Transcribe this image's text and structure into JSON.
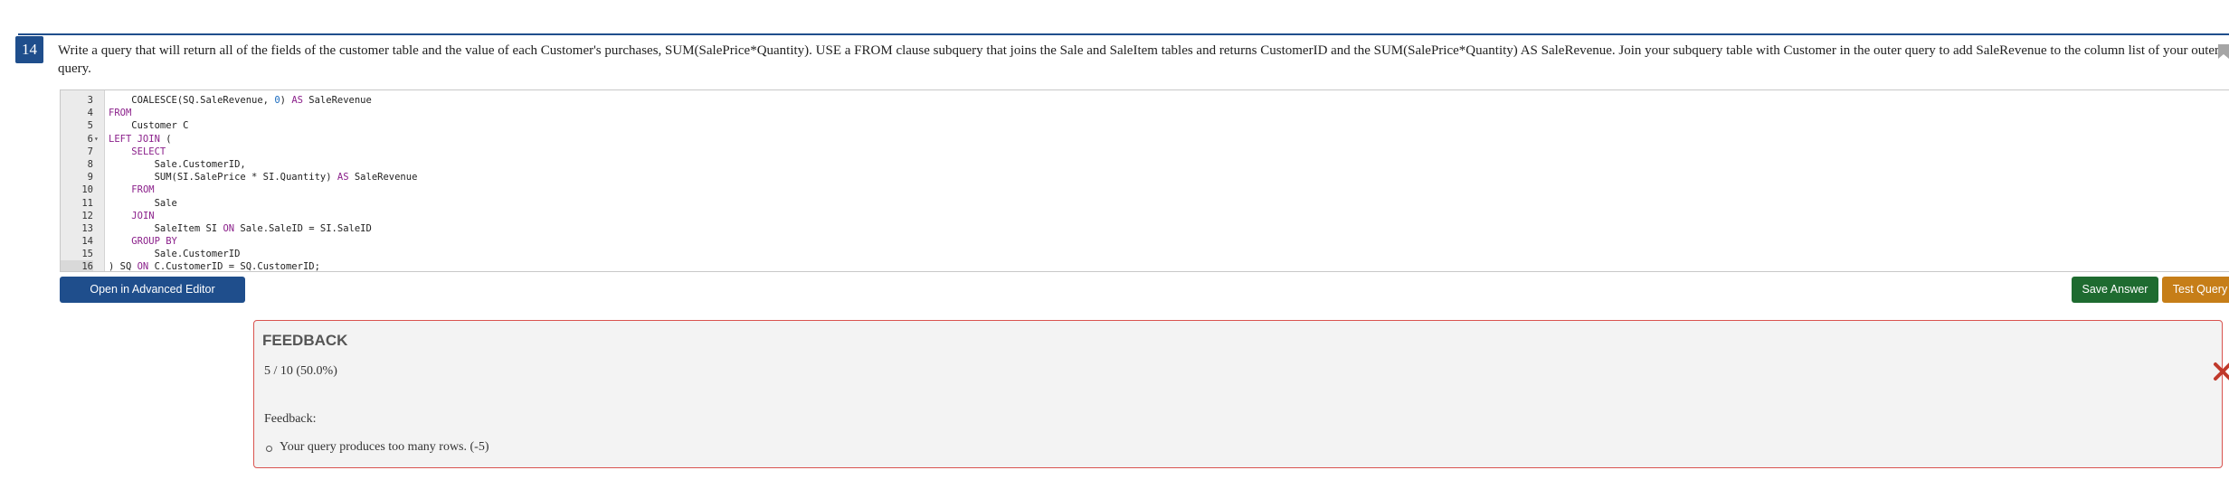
{
  "question": {
    "number": "14",
    "text": "Write a query that will return all of the fields of the customer table and the value of each Customer's purchases, SUM(SalePrice*Quantity). USE a FROM clause subquery that joins the Sale and SaleItem tables and returns CustomerID and the SUM(SalePrice*Quantity) AS SaleRevenue. Join your subquery table with Customer in the outer query to add SaleRevenue to the column list of your outer query."
  },
  "editor": {
    "lines": [
      {
        "n": "3",
        "fold": "",
        "code": "    COALESCE(SQ.SaleRevenue, 0) AS SaleRevenue"
      },
      {
        "n": "4",
        "fold": "",
        "code": "FROM"
      },
      {
        "n": "5",
        "fold": "",
        "code": "    Customer C"
      },
      {
        "n": "6",
        "fold": "▾",
        "code": "LEFT JOIN ("
      },
      {
        "n": "7",
        "fold": "",
        "code": "    SELECT"
      },
      {
        "n": "8",
        "fold": "",
        "code": "        Sale.CustomerID,"
      },
      {
        "n": "9",
        "fold": "",
        "code": "        SUM(SI.SalePrice * SI.Quantity) AS SaleRevenue"
      },
      {
        "n": "10",
        "fold": "",
        "code": "    FROM"
      },
      {
        "n": "11",
        "fold": "",
        "code": "        Sale"
      },
      {
        "n": "12",
        "fold": "",
        "code": "    JOIN"
      },
      {
        "n": "13",
        "fold": "",
        "code": "        SaleItem SI ON Sale.SaleID = SI.SaleID"
      },
      {
        "n": "14",
        "fold": "",
        "code": "    GROUP BY"
      },
      {
        "n": "15",
        "fold": "",
        "code": "        Sale.CustomerID"
      },
      {
        "n": "16",
        "fold": "",
        "code": ") SQ ON C.CustomerID = SQ.CustomerID;"
      }
    ],
    "active_line": "16"
  },
  "buttons": {
    "advanced_editor": "Open in Advanced Editor",
    "save_answer": "Save Answer",
    "test_query": "Test Query"
  },
  "colors": {
    "primary": "#1f4e8c",
    "save": "#1e6b30",
    "test": "#c67e18",
    "feedback_border": "#d9534f",
    "close": "#c0392b"
  },
  "feedback": {
    "title": "FEEDBACK",
    "score": "5 / 10  (50.0%)",
    "label": "Feedback:",
    "items": [
      "Your query produces too many rows. (-5)"
    ]
  }
}
